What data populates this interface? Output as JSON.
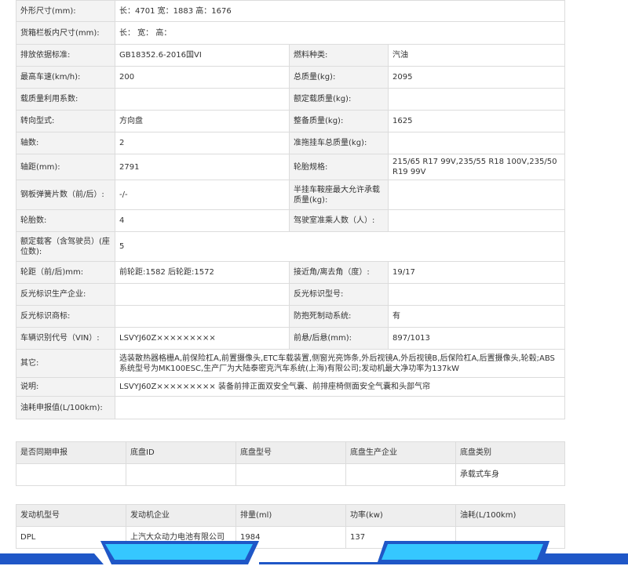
{
  "spec_rows": [
    {
      "type": "full",
      "label": "外形尺寸(mm):",
      "value": "长：4701 宽：1883 高：1676"
    },
    {
      "type": "full",
      "label": "货箱栏板内尺寸(mm):",
      "value": "长： 宽： 高："
    },
    {
      "type": "pair",
      "label1": "排放依据标准:",
      "value1": "GB18352.6-2016国VI",
      "label2": "燃料种类:",
      "value2": "汽油"
    },
    {
      "type": "pair",
      "label1": "最高车速(km/h):",
      "value1": "200",
      "label2": "总质量(kg):",
      "value2": "2095"
    },
    {
      "type": "pair",
      "label1": "载质量利用系数:",
      "value1": "",
      "label2": "额定载质量(kg):",
      "value2": ""
    },
    {
      "type": "pair",
      "label1": "转向型式:",
      "value1": "方向盘",
      "label2": "整备质量(kg):",
      "value2": "1625"
    },
    {
      "type": "pair",
      "label1": "轴数:",
      "value1": "2",
      "label2": "准拖挂车总质量(kg):",
      "value2": ""
    },
    {
      "type": "pair",
      "label1": "轴距(mm):",
      "value1": "2791",
      "label2": "轮胎规格:",
      "value2": "215/65 R17 99V,235/55 R18 100V,235/50 R19 99V"
    },
    {
      "type": "pair",
      "label1": "钢板弹簧片数（前/后）:",
      "value1": "-/-",
      "label2": "半挂车鞍座最大允许承载质量(kg):",
      "value2": ""
    },
    {
      "type": "pair",
      "label1": "轮胎数:",
      "value1": "4",
      "label2": "驾驶室准乘人数（人）:",
      "value2": ""
    },
    {
      "type": "full",
      "label": "额定载客（含驾驶员）(座位数):",
      "value": "5"
    },
    {
      "type": "pair",
      "label1": "轮距（前/后)mm:",
      "value1": "前轮距:1582 后轮距:1572",
      "label2": "接近角/离去角（度）:",
      "value2": "19/17"
    },
    {
      "type": "pair",
      "label1": "反光标识生产企业:",
      "value1": "",
      "label2": "反光标识型号:",
      "value2": ""
    },
    {
      "type": "pair",
      "label1": "反光标识商标:",
      "value1": "",
      "label2": "防抱死制动系统:",
      "value2": "有"
    },
    {
      "type": "pair",
      "label1": "车辆识别代号（VIN）:",
      "value1": "LSVYJ60Z×××××××××",
      "label2": "前悬/后悬(mm):",
      "value2": "897/1013"
    },
    {
      "type": "full",
      "label": "其它:",
      "value": "选装散热器格栅A,前保险杠A,前置摄像头,ETC车载装置,侧窗光亮饰条,外后视镜A,外后视镜B,后保险杠A,后置摄像头,轮毂;ABS系统型号为MK100ESC,生产厂为大陆泰密克汽车系统(上海)有限公司;发动机最大净功率为137kW"
    },
    {
      "type": "full",
      "label": "说明:",
      "value": "LSVYJ60Z××××××××× 装备前排正面双安全气囊、前排座椅侧面安全气囊和头部气帘"
    },
    {
      "type": "full",
      "label": "油耗申报值(L/100km):",
      "value": ""
    }
  ],
  "chassis": {
    "headers": [
      "是否同期申报",
      "底盘ID",
      "底盘型号",
      "底盘生产企业",
      "底盘类别"
    ],
    "rows": [
      [
        "",
        "",
        "",
        "",
        "承载式车身"
      ]
    ]
  },
  "engine": {
    "headers": [
      "发动机型号",
      "发动机企业",
      "排量(ml)",
      "功率(kw)",
      "油耗(L/100km)"
    ],
    "rows": [
      [
        "DPL",
        "上汽大众动力电池有限公司",
        "1984",
        "137",
        ""
      ]
    ]
  },
  "colors": {
    "label_bg": "#f3f3f3",
    "border": "#dcdcdc",
    "deco_blue": "#1f57c7",
    "deco_cyan": "#35c7ff"
  }
}
